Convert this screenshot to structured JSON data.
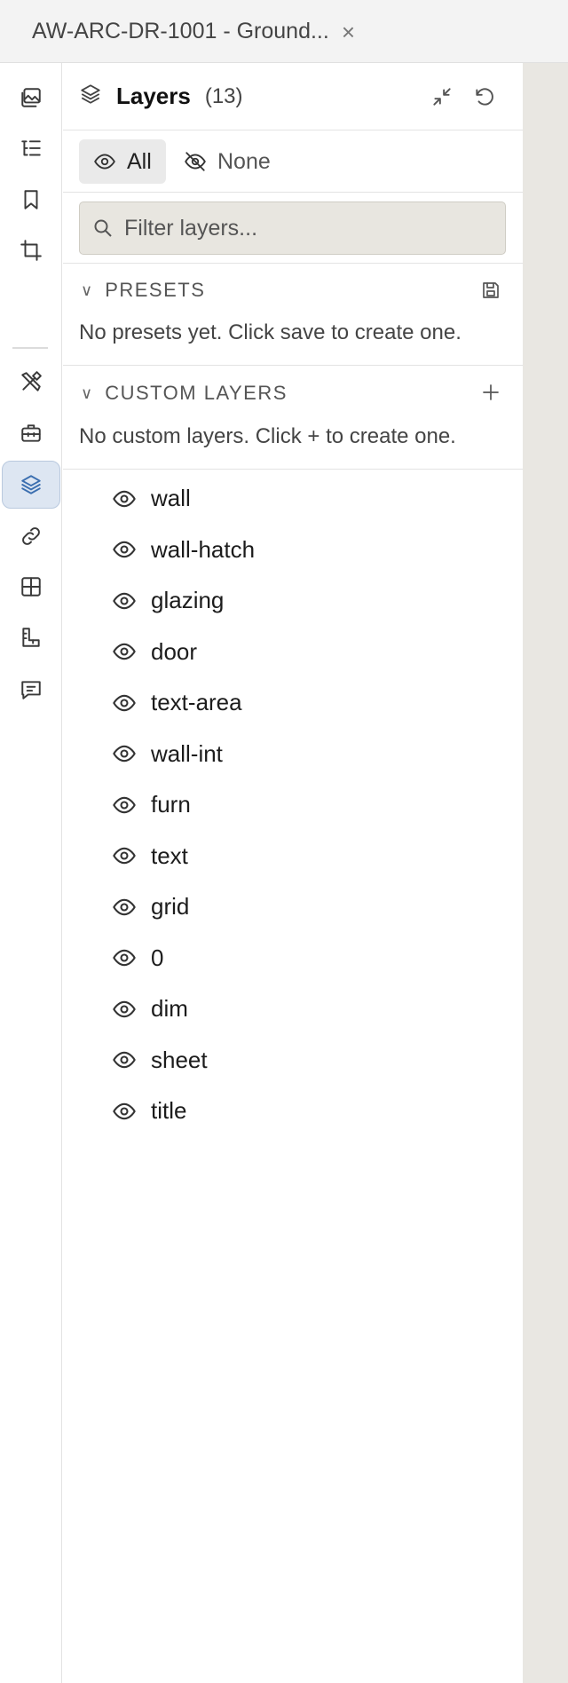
{
  "tab": {
    "title": "AW-ARC-DR-1001 - Ground...",
    "close_glyph": "×"
  },
  "rail": {
    "items": [
      {
        "icon": "images-icon"
      },
      {
        "icon": "outline-list-icon"
      },
      {
        "icon": "bookmark-icon"
      },
      {
        "icon": "crop-icon"
      },
      {
        "icon": "tools-icon"
      },
      {
        "icon": "toolbox-icon"
      },
      {
        "icon": "layers-icon",
        "active": true
      },
      {
        "icon": "link-icon"
      },
      {
        "icon": "grid-icon"
      },
      {
        "icon": "measure-icon"
      },
      {
        "icon": "comment-icon"
      }
    ]
  },
  "panel": {
    "title": "Layers",
    "count": "(13)",
    "visibility": {
      "all_label": "All",
      "none_label": "None",
      "selected": "All"
    },
    "filter": {
      "placeholder": "Filter layers...",
      "value": ""
    },
    "presets": {
      "title": "PRESETS",
      "empty_text": "No presets yet. Click save to create one."
    },
    "custom": {
      "title": "CUSTOM LAYERS",
      "empty_text": "No custom layers. Click + to create one."
    },
    "layers": [
      "wall",
      "wall-hatch",
      "glazing",
      "door",
      "text-area",
      "wall-int",
      "furn",
      "text",
      "grid",
      "0",
      "dim",
      "sheet",
      "title"
    ]
  },
  "colors": {
    "accent": "#3b6fb0",
    "active_bg": "#dde6f2",
    "canvas_bg": "#e9e7e2",
    "filter_bg": "#e8e6e0"
  }
}
